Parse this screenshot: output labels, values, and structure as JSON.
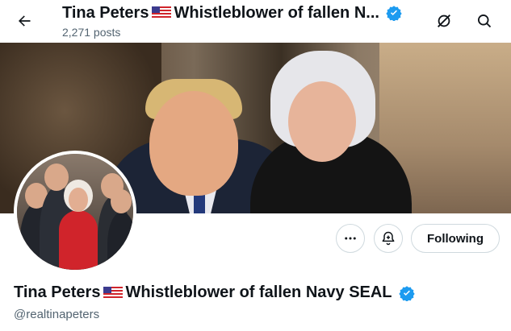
{
  "header": {
    "title_name": "Tina Peters",
    "title_rest": "Whistleblower of fallen N...",
    "posts_count": "2,271 posts"
  },
  "profile": {
    "display_name": "Tina Peters",
    "display_rest": "Whistleblower of fallen Navy SEAL",
    "handle": "@realtinapeters",
    "follow_label": "Following",
    "verified": true
  },
  "icons": {
    "back": "back-arrow-icon",
    "grok": "grok-icon",
    "search": "search-icon",
    "more": "more-options-icon",
    "notify": "notification-bell-icon",
    "flag": "us-flag-icon",
    "verified": "verified-badge-icon"
  },
  "colors": {
    "verified_blue": "#1d9bf0",
    "text_primary": "#0f1419",
    "text_secondary": "#536471",
    "border": "#cfd9de"
  }
}
